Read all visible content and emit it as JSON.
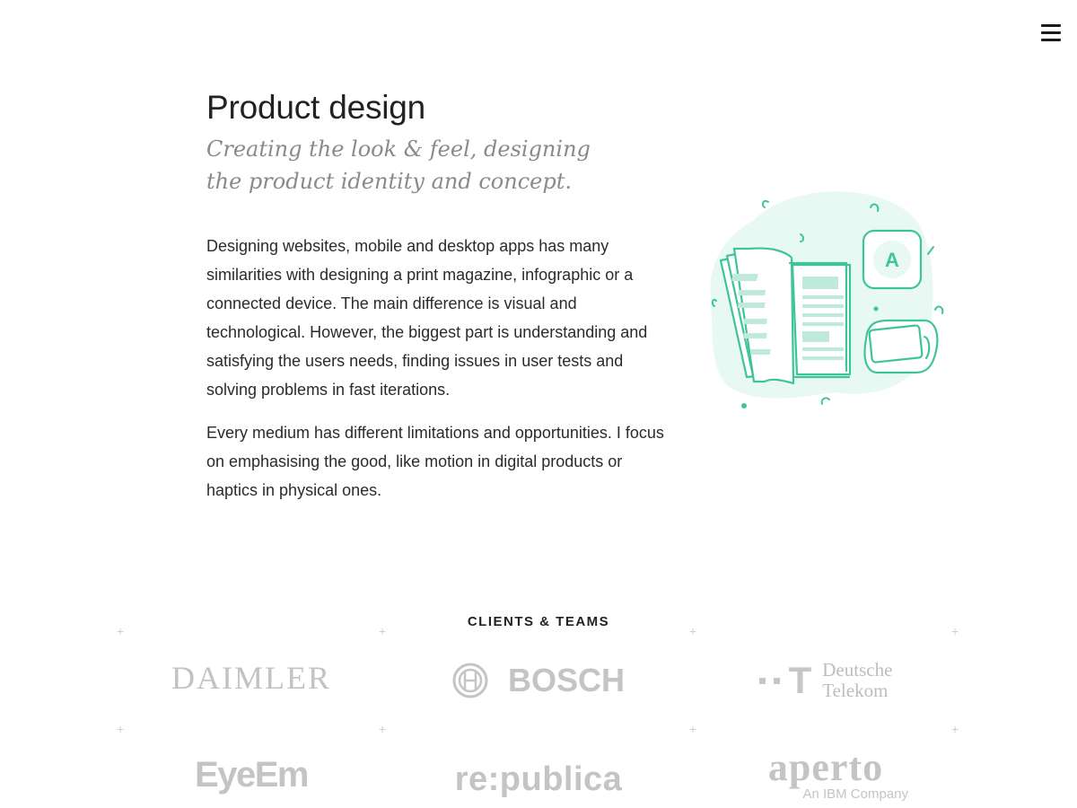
{
  "nav": {
    "menu_icon": "hamburger-menu-icon"
  },
  "main": {
    "title": "Product design",
    "subtitle": "Creating the look & feel, designing the product identity and concept.",
    "paragraphs": [
      "Designing websites, mobile and desktop apps has many similarities with designing a print magazine, infographic or a connected device. The main difference is visual and technological. However, the biggest part is understanding and satisfying the users needs, finding issues in user tests and solving problems in fast iterations.",
      "Every medium has different limitations and opportunities. I focus on emphasising the good, like motion in digital products or haptics in physical ones."
    ],
    "illustration": {
      "icon": "print-and-devices-illustration",
      "badge_letter": "A",
      "accent_color": "#3ec49a",
      "blob_color": "#e8f8f2"
    }
  },
  "clients": {
    "heading": "CLIENTS & TEAMS",
    "logo_color": "#c4c4c4",
    "logos": [
      {
        "name": "DAIMLER"
      },
      {
        "name": "BOSCH"
      },
      {
        "name": "Deutsche Telekom",
        "line1": "Deutsche",
        "line2": "Telekom",
        "mark": "T"
      },
      {
        "name": "EyeEm"
      },
      {
        "name": "re:publica"
      },
      {
        "name": "aperto",
        "tagline": "An IBM Company"
      }
    ]
  }
}
